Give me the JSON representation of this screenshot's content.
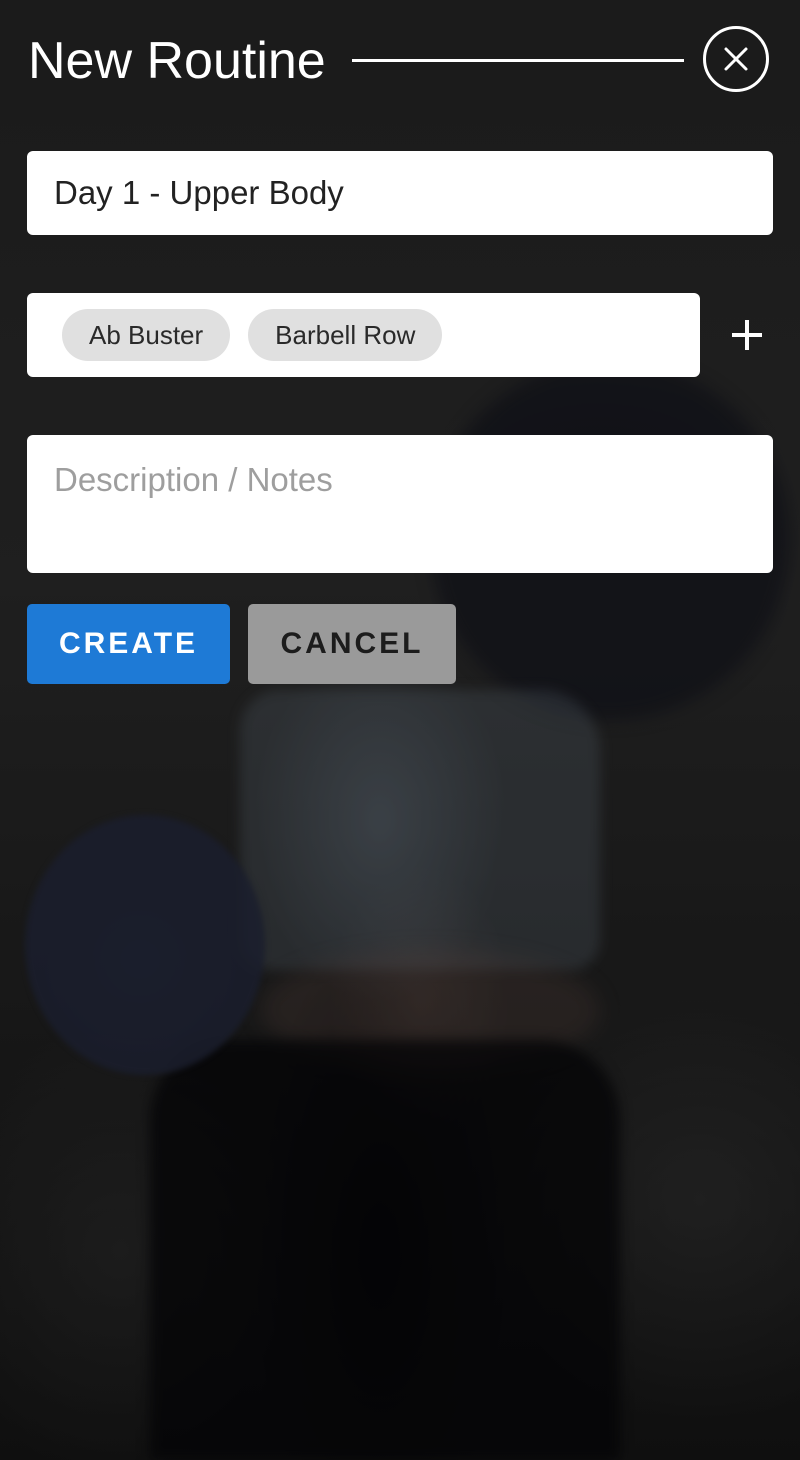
{
  "header": {
    "title": "New Routine"
  },
  "form": {
    "routine_name": "Day 1 - Upper Body",
    "exercises": [
      "Ab Buster",
      "Barbell Row"
    ],
    "notes_placeholder": "Description / Notes"
  },
  "actions": {
    "create_label": "CREATE",
    "cancel_label": "CANCEL"
  },
  "colors": {
    "primary": "#1e7ad6",
    "cancel": "#9a9a9a",
    "chip": "#e0e0e0"
  },
  "icons": {
    "close": "close-icon",
    "add": "plus-icon"
  }
}
